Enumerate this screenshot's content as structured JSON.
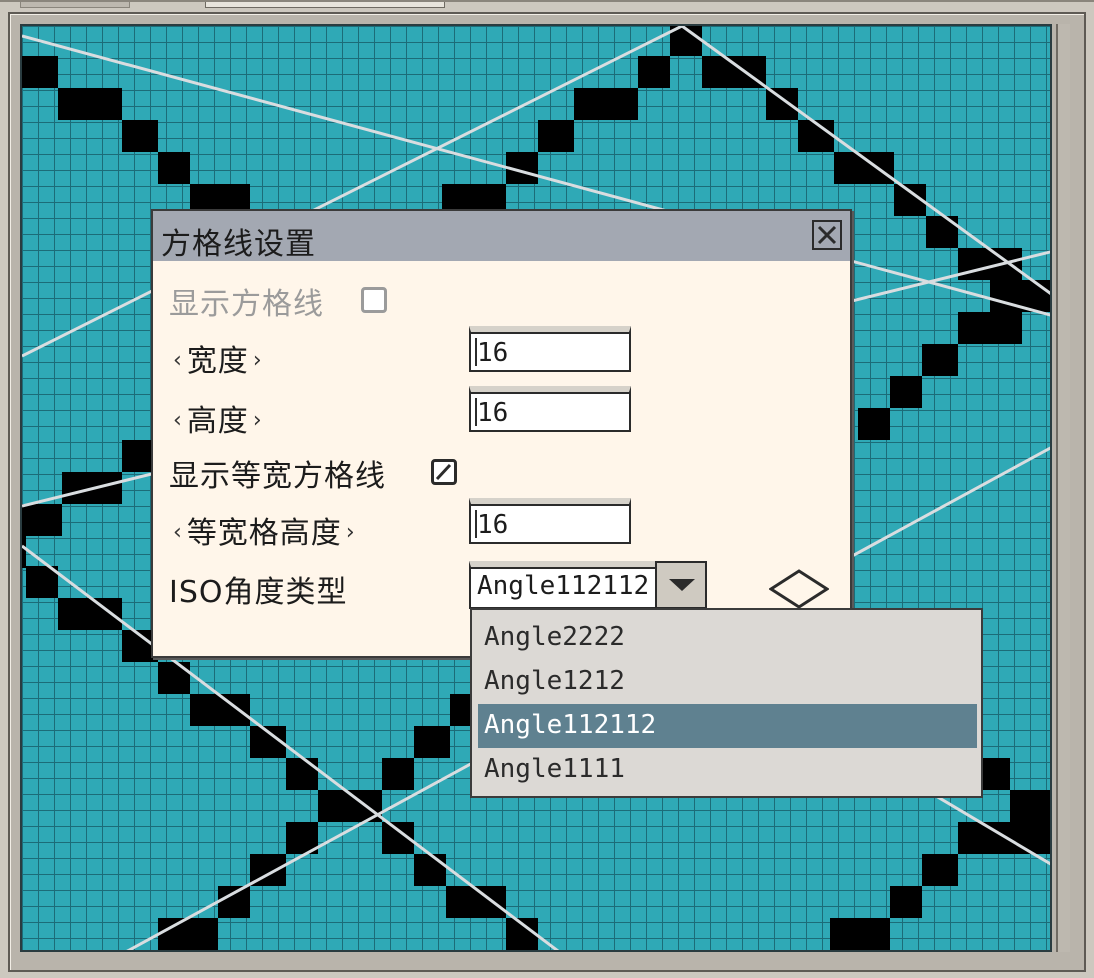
{
  "dialog": {
    "title": "方格线设置",
    "show_grid_label": "显示方格线",
    "show_grid_checked": false,
    "width_label": "宽度",
    "width_value": "16",
    "height_label": "高度",
    "height_value": "16",
    "show_equal_grid_label": "显示等宽方格线",
    "show_equal_grid_checked": true,
    "equal_grid_height_label": "等宽格高度",
    "equal_grid_height_value": "16",
    "iso_angle_label": "ISO角度类型",
    "iso_angle_value": "Angle112112"
  },
  "dropdown": {
    "options": [
      "Angle2222",
      "Angle1212",
      "Angle112112",
      "Angle1111"
    ],
    "selected_index": 2
  },
  "colors": {
    "canvas_bg": "#2fa9b6",
    "grid_line": "#1c6c78",
    "dialog_bg": "#fff6ea",
    "titlebar": "#a3a8b2",
    "selected_item": "#5f8190"
  }
}
